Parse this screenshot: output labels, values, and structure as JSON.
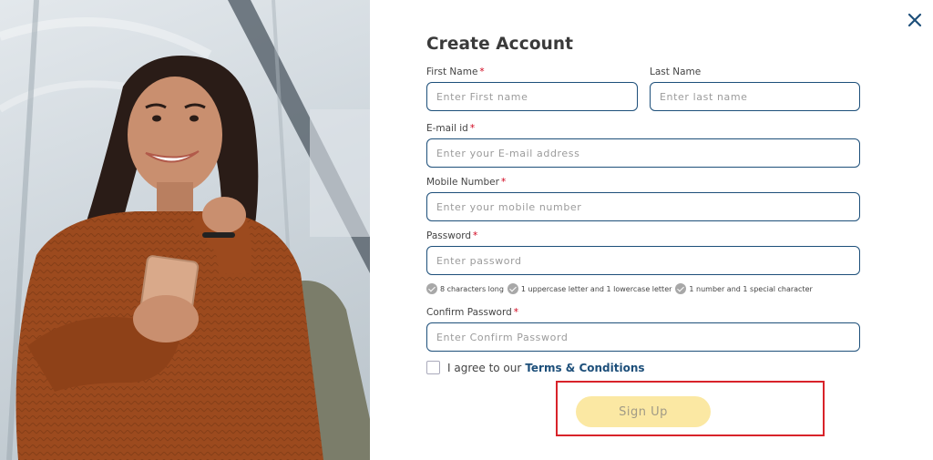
{
  "form": {
    "title": "Create Account",
    "first_name": {
      "label": "First Name",
      "required": "*",
      "placeholder": "Enter First name"
    },
    "last_name": {
      "label": "Last Name",
      "placeholder": "Enter last name"
    },
    "email": {
      "label": "E-mail id",
      "required": "*",
      "placeholder": "Enter your E-mail address"
    },
    "mobile": {
      "label": "Mobile Number",
      "required": "*",
      "placeholder": "Enter your mobile number"
    },
    "password": {
      "label": "Password",
      "required": "*",
      "placeholder": "Enter password"
    },
    "password_rules": [
      "8 characters long",
      "1 uppercase letter and 1 lowercase letter",
      "1 number and 1 special character"
    ],
    "confirm_password": {
      "label": "Confirm Password",
      "required": "*",
      "placeholder": "Enter Confirm Password"
    },
    "agree_text": "I agree to our",
    "terms_link": "Terms & Conditions",
    "signup_label": "Sign Up"
  },
  "icons": {
    "close": "close-icon",
    "check": "check-circle-icon"
  },
  "colors": {
    "accent": "#1d4f7a",
    "required": "#d0021b",
    "button_bg": "#fbe8a3",
    "highlight": "#d8232a"
  }
}
